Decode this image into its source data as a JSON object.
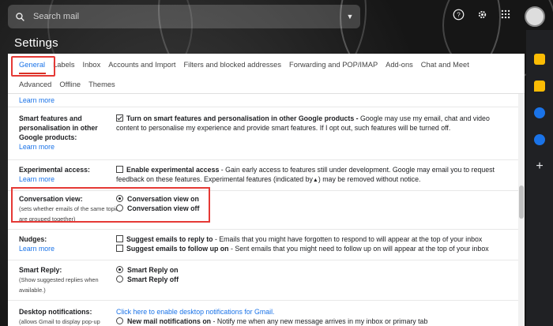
{
  "search": {
    "placeholder": "Search mail"
  },
  "header": {
    "title": "Settings"
  },
  "tabs": {
    "row1": [
      "General",
      "Labels",
      "Inbox",
      "Accounts and Import",
      "Filters and blocked addresses",
      "Forwarding and POP/IMAP",
      "Add-ons",
      "Chat and Meet"
    ],
    "row2": [
      "Advanced",
      "Offline",
      "Themes"
    ],
    "active": "General"
  },
  "sections": {
    "top_link": "Learn more",
    "smart_features": {
      "label": "Smart features and personalisation in other Google products:",
      "link": "Learn more",
      "option_bold": "Turn on smart features and personalisation in other Google products -",
      "option_text": " Google may use my email, chat and video content to personalise my experience and provide smart features. If I opt out, such features will be turned off."
    },
    "experimental": {
      "label": "Experimental access:",
      "link": "Learn more",
      "option_bold": "Enable experimental access",
      "option_text": " - Gain early access to features still under development. Google may email you to request feedback on these features. Experimental features (indicated by",
      "option_tail": ") may be removed without notice."
    },
    "conversation": {
      "label": "Conversation view:",
      "sub": "(sets whether emails of the same topic are grouped together)",
      "on": "Conversation view on",
      "off": "Conversation view off"
    },
    "nudges": {
      "label": "Nudges:",
      "link": "Learn more",
      "opt1_bold": "Suggest emails to reply to",
      "opt1_text": " - Emails that you might have forgotten to respond to will appear at the top of your inbox",
      "opt2_bold": "Suggest emails to follow up on",
      "opt2_text": " - Sent emails that you might need to follow up on will appear at the top of your inbox"
    },
    "smart_reply": {
      "label": "Smart Reply:",
      "sub": "(Show suggested replies when available.)",
      "on": "Smart Reply on",
      "off": "Smart Reply off"
    },
    "desktop": {
      "label": "Desktop notifications:",
      "sub": "(allows Gmail to display pop-up",
      "link": "Click here to enable desktop notifications for Gmail.",
      "opt_bold": "New mail notifications on",
      "opt_text": " - Notify me when any new message arrives in my inbox or primary tab"
    }
  },
  "colors": {
    "accent": "#1a73e8",
    "highlight": "#e53935"
  }
}
